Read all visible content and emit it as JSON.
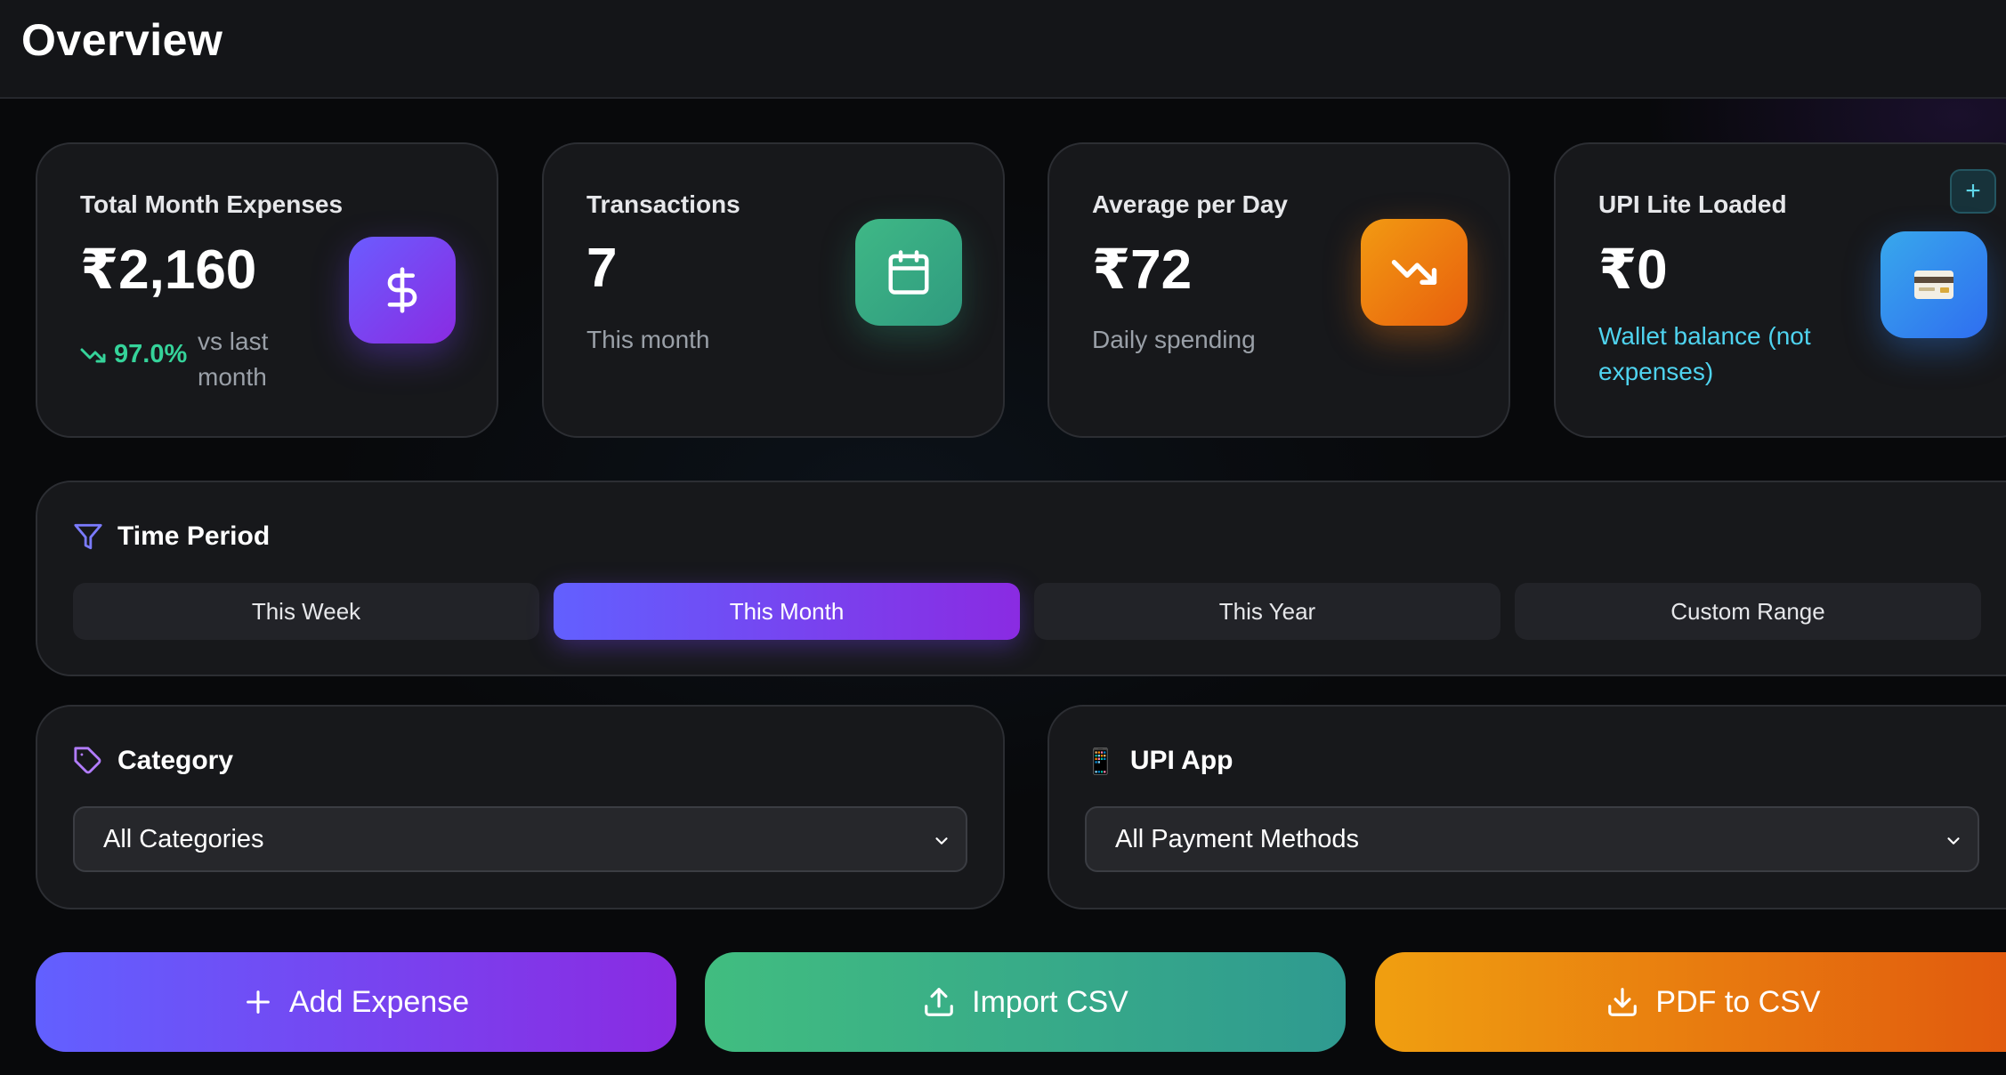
{
  "header": {
    "title": "Overview"
  },
  "stats": [
    {
      "label": "Total Month Expenses",
      "value": "₹2,160",
      "trend": "97.0%",
      "trend_sub": "vs last month",
      "icon": "dollar-icon"
    },
    {
      "label": "Transactions",
      "value": "7",
      "sub": "This month",
      "icon": "calendar-icon"
    },
    {
      "label": "Average per Day",
      "value": "₹72",
      "sub": "Daily spending",
      "icon": "trending-down-icon"
    },
    {
      "label": "UPI Lite Loaded",
      "value": "₹0",
      "sub": "Wallet balance (not expenses)",
      "icon": "credit-card-icon",
      "add_label": "+"
    }
  ],
  "time_period": {
    "title": "Time Period",
    "options": [
      "This Week",
      "This Month",
      "This Year",
      "Custom Range"
    ],
    "selected": "This Month"
  },
  "category": {
    "title": "Category",
    "selected": "All Categories"
  },
  "upi_app": {
    "title": "UPI App",
    "icon_glyph": "📱",
    "selected": "All Payment Methods"
  },
  "actions": {
    "add": "Add Expense",
    "import": "Import CSV",
    "pdf": "PDF to CSV"
  },
  "colors": {
    "accent_purple": "#6b5cff",
    "accent_green": "#3fb886",
    "accent_orange": "#f29a12",
    "accent_blue": "#38a8ec",
    "trend_green": "#35d39a",
    "wallet_cyan": "#4fd3ef"
  }
}
